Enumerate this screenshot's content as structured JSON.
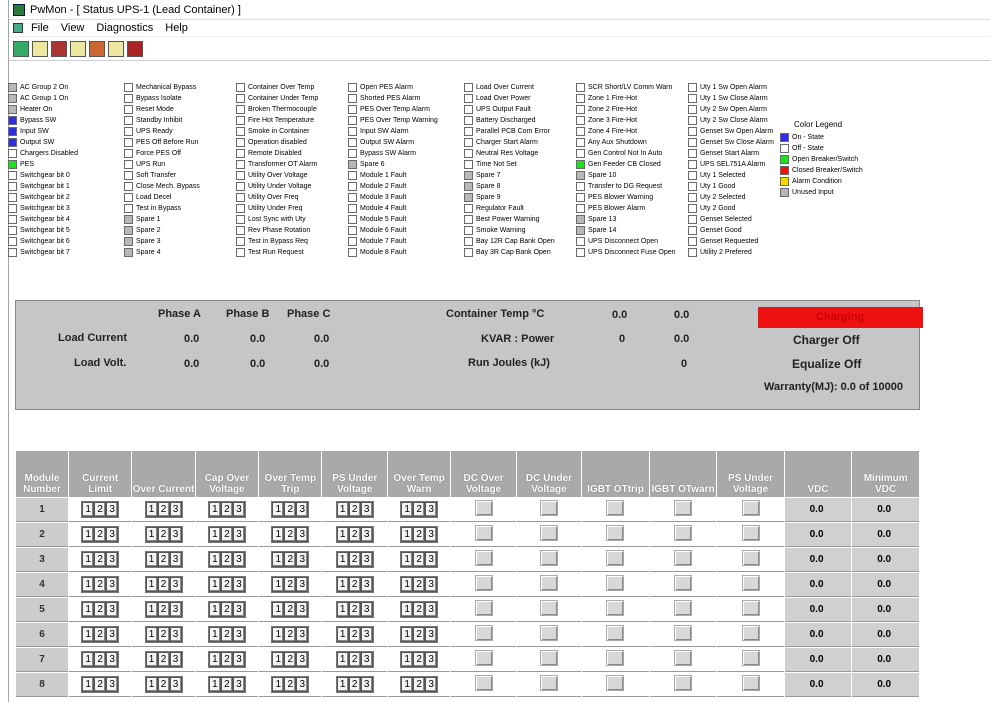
{
  "window": {
    "title": "PwMon - [ Status UPS-1 (Lead Container) ]"
  },
  "menu": [
    "File",
    "View",
    "Diagnostics",
    "Help"
  ],
  "toolbar_icons": [
    "grid-icon",
    "module-icon",
    "flame-icon",
    "alarm-icon",
    "chart-icon",
    "record-icon",
    "stop-icon"
  ],
  "status_columns": [
    [
      {
        "label": "AC Group 2 On",
        "state": "gray"
      },
      {
        "label": "AC Group 1 On",
        "state": "gray"
      },
      {
        "label": "Heater On",
        "state": "gray"
      },
      {
        "label": "Bypass SW",
        "state": "on"
      },
      {
        "label": "Input SW",
        "state": "on"
      },
      {
        "label": "Output SW",
        "state": "on"
      },
      {
        "label": "Chargers Disabled",
        "state": "off"
      },
      {
        "label": "PES",
        "state": "green"
      },
      {
        "label": "Switchgear bit 0",
        "state": "off"
      },
      {
        "label": "Switchgear bit 1",
        "state": "off"
      },
      {
        "label": "Switchgear bit 2",
        "state": "off"
      },
      {
        "label": "Switchgear bit 3",
        "state": "off"
      },
      {
        "label": "Switchgear bit 4",
        "state": "off"
      },
      {
        "label": "Switchgear bit 5",
        "state": "off"
      },
      {
        "label": "Switchgear bit 6",
        "state": "off"
      },
      {
        "label": "Switchgear bit 7",
        "state": "off"
      }
    ],
    [
      {
        "label": "Mechanical Bypass",
        "state": "off"
      },
      {
        "label": "Bypass Isolate",
        "state": "off"
      },
      {
        "label": "Reset Mode",
        "state": "off"
      },
      {
        "label": "Standby Inhibit",
        "state": "off"
      },
      {
        "label": "UPS Ready",
        "state": "off"
      },
      {
        "label": "PES Off Before Run",
        "state": "off"
      },
      {
        "label": "Force PES Off",
        "state": "off"
      },
      {
        "label": "UPS Run",
        "state": "off"
      },
      {
        "label": "Soft Transfer",
        "state": "off"
      },
      {
        "label": "Close Mech. Bypass",
        "state": "off"
      },
      {
        "label": "Load Decel",
        "state": "off"
      },
      {
        "label": "Test in Bypass",
        "state": "off"
      },
      {
        "label": "Spare 1",
        "state": "gray"
      },
      {
        "label": "Spare 2",
        "state": "gray"
      },
      {
        "label": "Spare 3",
        "state": "gray"
      },
      {
        "label": "Spare 4",
        "state": "gray"
      }
    ],
    [
      {
        "label": "Container Over Temp",
        "state": "off"
      },
      {
        "label": "Container Under Temp",
        "state": "off"
      },
      {
        "label": "Broken Thermocouple",
        "state": "off"
      },
      {
        "label": "Fire Hot Temperature",
        "state": "off"
      },
      {
        "label": "Smoke in Container",
        "state": "off"
      },
      {
        "label": "Operation disabled",
        "state": "off"
      },
      {
        "label": "Remote Disabled",
        "state": "off"
      },
      {
        "label": "Transformer OT Alarm",
        "state": "off"
      },
      {
        "label": "Utility Over Voltage",
        "state": "off"
      },
      {
        "label": "Utility Under Voltage",
        "state": "off"
      },
      {
        "label": "Utility Over Freq",
        "state": "off"
      },
      {
        "label": "Utility Under Freq",
        "state": "off"
      },
      {
        "label": "Lost Sync with Uty",
        "state": "off"
      },
      {
        "label": "Rev Phase Rotation",
        "state": "off"
      },
      {
        "label": "Test in Bypass Req",
        "state": "off"
      },
      {
        "label": "Test Run Request",
        "state": "off"
      }
    ],
    [
      {
        "label": "Open PES Alarm",
        "state": "off"
      },
      {
        "label": "Shorted PES Alarm",
        "state": "off"
      },
      {
        "label": "PES Over Temp Alarm",
        "state": "off"
      },
      {
        "label": "PES Over Temp Warning",
        "state": "off"
      },
      {
        "label": "Input SW Alarm",
        "state": "off"
      },
      {
        "label": "Output SW Alarm",
        "state": "off"
      },
      {
        "label": "Bypass SW Alarm",
        "state": "off"
      },
      {
        "label": "Spare 6",
        "state": "gray"
      },
      {
        "label": "Module 1 Fault",
        "state": "off"
      },
      {
        "label": "Module 2 Fault",
        "state": "off"
      },
      {
        "label": "Module 3 Fault",
        "state": "off"
      },
      {
        "label": "Module 4 Fault",
        "state": "off"
      },
      {
        "label": "Module 5 Fault",
        "state": "off"
      },
      {
        "label": "Module 6 Fault",
        "state": "off"
      },
      {
        "label": "Module 7 Fault",
        "state": "off"
      },
      {
        "label": "Module 8 Fault",
        "state": "off"
      }
    ],
    [
      {
        "label": "Load Over Current",
        "state": "off"
      },
      {
        "label": "Load Over Power",
        "state": "off"
      },
      {
        "label": "UPS Output Fault",
        "state": "off"
      },
      {
        "label": "Battery Discharged",
        "state": "off"
      },
      {
        "label": "Parallel PCB Com Error",
        "state": "off"
      },
      {
        "label": "Charger Start Alarm",
        "state": "off"
      },
      {
        "label": "Neutral Res Voltage",
        "state": "off"
      },
      {
        "label": "Time Not Set",
        "state": "off"
      },
      {
        "label": "Spare 7",
        "state": "gray"
      },
      {
        "label": "Spare 8",
        "state": "gray"
      },
      {
        "label": "Spare 9",
        "state": "gray"
      },
      {
        "label": "Regulator Fault",
        "state": "off"
      },
      {
        "label": "Best Power Warning",
        "state": "off"
      },
      {
        "label": "Smoke Warning",
        "state": "off"
      },
      {
        "label": "Bay 12R Cap Bank Open",
        "state": "off"
      },
      {
        "label": "Bay 3R Cap Bank Open",
        "state": "off"
      }
    ],
    [
      {
        "label": "SCR Short/LV Comm Warn",
        "state": "off"
      },
      {
        "label": "Zone 1 Fire-Hot",
        "state": "off"
      },
      {
        "label": "Zone 2 Fire-Hot",
        "state": "off"
      },
      {
        "label": "Zone 3 Fire-Hot",
        "state": "off"
      },
      {
        "label": "Zone 4 Fire-Hot",
        "state": "off"
      },
      {
        "label": "Any Aux Shutdown",
        "state": "off"
      },
      {
        "label": "Gen Control Not In Auto",
        "state": "off"
      },
      {
        "label": "Gen Feeder CB Closed",
        "state": "green"
      },
      {
        "label": "Spare 10",
        "state": "gray"
      },
      {
        "label": "Transfer to DG Request",
        "state": "off"
      },
      {
        "label": "PES Blower Warning",
        "state": "off"
      },
      {
        "label": "PES Blower Alarm",
        "state": "off"
      },
      {
        "label": "Spare 13",
        "state": "gray"
      },
      {
        "label": "Spare 14",
        "state": "gray"
      },
      {
        "label": "UPS Disconnect Open",
        "state": "off"
      },
      {
        "label": "UPS Disconnect Fuse Open",
        "state": "off"
      }
    ],
    [
      {
        "label": "Uty 1 Sw Open Alarm",
        "state": "off"
      },
      {
        "label": "Uty 1 Sw Close Alarm",
        "state": "off"
      },
      {
        "label": "Uty 2 Sw Open Alarm",
        "state": "off"
      },
      {
        "label": "Uty 2 Sw Close Alarm",
        "state": "off"
      },
      {
        "label": "Genset Sw Open Alarm",
        "state": "off"
      },
      {
        "label": "Genset Sw Close Alarm",
        "state": "off"
      },
      {
        "label": "Genset Start Alarm",
        "state": "off"
      },
      {
        "label": "UPS SEL751A Alarm",
        "state": "off"
      },
      {
        "label": "Uty 1 Selected",
        "state": "off"
      },
      {
        "label": "Uty 1 Good",
        "state": "off"
      },
      {
        "label": "Uty 2 Selected",
        "state": "off"
      },
      {
        "label": "Uty 2 Good",
        "state": "off"
      },
      {
        "label": "Genset Selected",
        "state": "off"
      },
      {
        "label": "Genset Good",
        "state": "off"
      },
      {
        "label": "Genset Requested",
        "state": "off"
      },
      {
        "label": "Utility 2 Prefered",
        "state": "off"
      }
    ]
  ],
  "legend": {
    "title": "Color Legend",
    "items": [
      {
        "label": "On - State",
        "color": "#2f2fe0"
      },
      {
        "label": "Off - State",
        "color": "#ffffff"
      },
      {
        "label": "Open Breaker/Switch",
        "color": "#22dd22"
      },
      {
        "label": "Closed Breaker/Switch",
        "color": "#ee1111"
      },
      {
        "label": "Alarm Condition",
        "color": "#ffd700"
      },
      {
        "label": "Unused Input",
        "color": "#b8b8b8"
      }
    ]
  },
  "panel": {
    "phase_a": "Phase A",
    "phase_b": "Phase B",
    "phase_c": "Phase C",
    "load_current": "Load Current",
    "load_volt": "Load Volt.",
    "lc_a": "0.0",
    "lc_b": "0.0",
    "lc_c": "0.0",
    "lv_a": "0.0",
    "lv_b": "0.0",
    "lv_c": "0.0",
    "container_temp": "Container Temp °C",
    "ct_v1": "0.0",
    "ct_v2": "0.0",
    "kvar_power": "KVAR : Power",
    "kvar_v1": "0",
    "kvar_v2": "0.0",
    "run_joules": "Run Joules (kJ)",
    "rj_v": "0",
    "charger_box_text": "Charging",
    "charger_off": "Charger Off",
    "equalize_off": "Equalize Off",
    "warranty": "Warranty(MJ): 0.0 of 10000"
  },
  "module_table": {
    "headers": [
      "Module Number",
      "Current Limit",
      "Over Current",
      "Cap Over Voltage",
      "Over Temp Trip",
      "PS Under Voltage",
      "Over Temp Warn",
      "DC Over Voltage",
      "DC Under Voltage",
      "IGBT OTtrip",
      "IGBT OTwarn",
      "PS Under Voltage",
      "VDC",
      "Minimum VDC"
    ],
    "tri_labels": [
      "1",
      "2",
      "3"
    ],
    "rows": [
      {
        "num": "1",
        "vdc": "0.0",
        "min": "0.0"
      },
      {
        "num": "2",
        "vdc": "0.0",
        "min": "0.0"
      },
      {
        "num": "3",
        "vdc": "0.0",
        "min": "0.0"
      },
      {
        "num": "4",
        "vdc": "0.0",
        "min": "0.0"
      },
      {
        "num": "5",
        "vdc": "0.0",
        "min": "0.0"
      },
      {
        "num": "6",
        "vdc": "0.0",
        "min": "0.0"
      },
      {
        "num": "7",
        "vdc": "0.0",
        "min": "0.0"
      },
      {
        "num": "8",
        "vdc": "0.0",
        "min": "0.0"
      }
    ]
  }
}
